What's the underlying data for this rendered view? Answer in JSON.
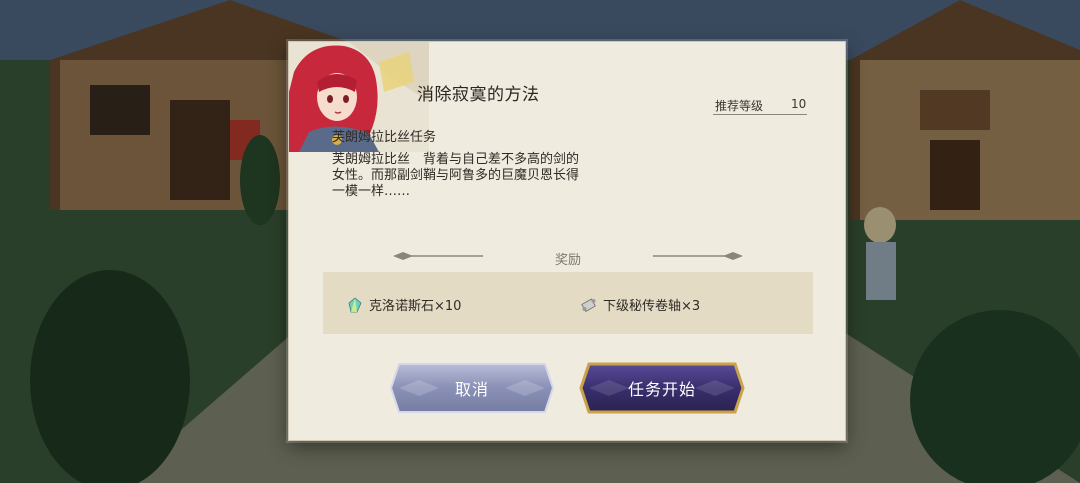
{
  "dialog": {
    "title": "消除寂寞的方法",
    "recommended_level_label": "推荐等级",
    "recommended_level_value": "10",
    "quest_type": "芙朗姆拉比丝任务",
    "description": "芙朗姆拉比丝　背着与自己差不多高的剑的女性。而那副剑鞘与阿鲁多的巨魔贝恩长得一模一样……",
    "rewards_heading": "奖励",
    "rewards": [
      {
        "label": "克洛诺斯石×10",
        "icon": "crystal-icon"
      },
      {
        "label": "下级秘传卷轴×3",
        "icon": "scroll-icon"
      }
    ],
    "cancel_label": "取消",
    "start_label": "任务开始"
  },
  "colors": {
    "dialog_bg": "#efebdf",
    "reward_box_bg": "#e4dbc4",
    "cancel_button": "#8c93b8",
    "start_button": "#3a2f6e",
    "start_border": "#c9a24a"
  }
}
